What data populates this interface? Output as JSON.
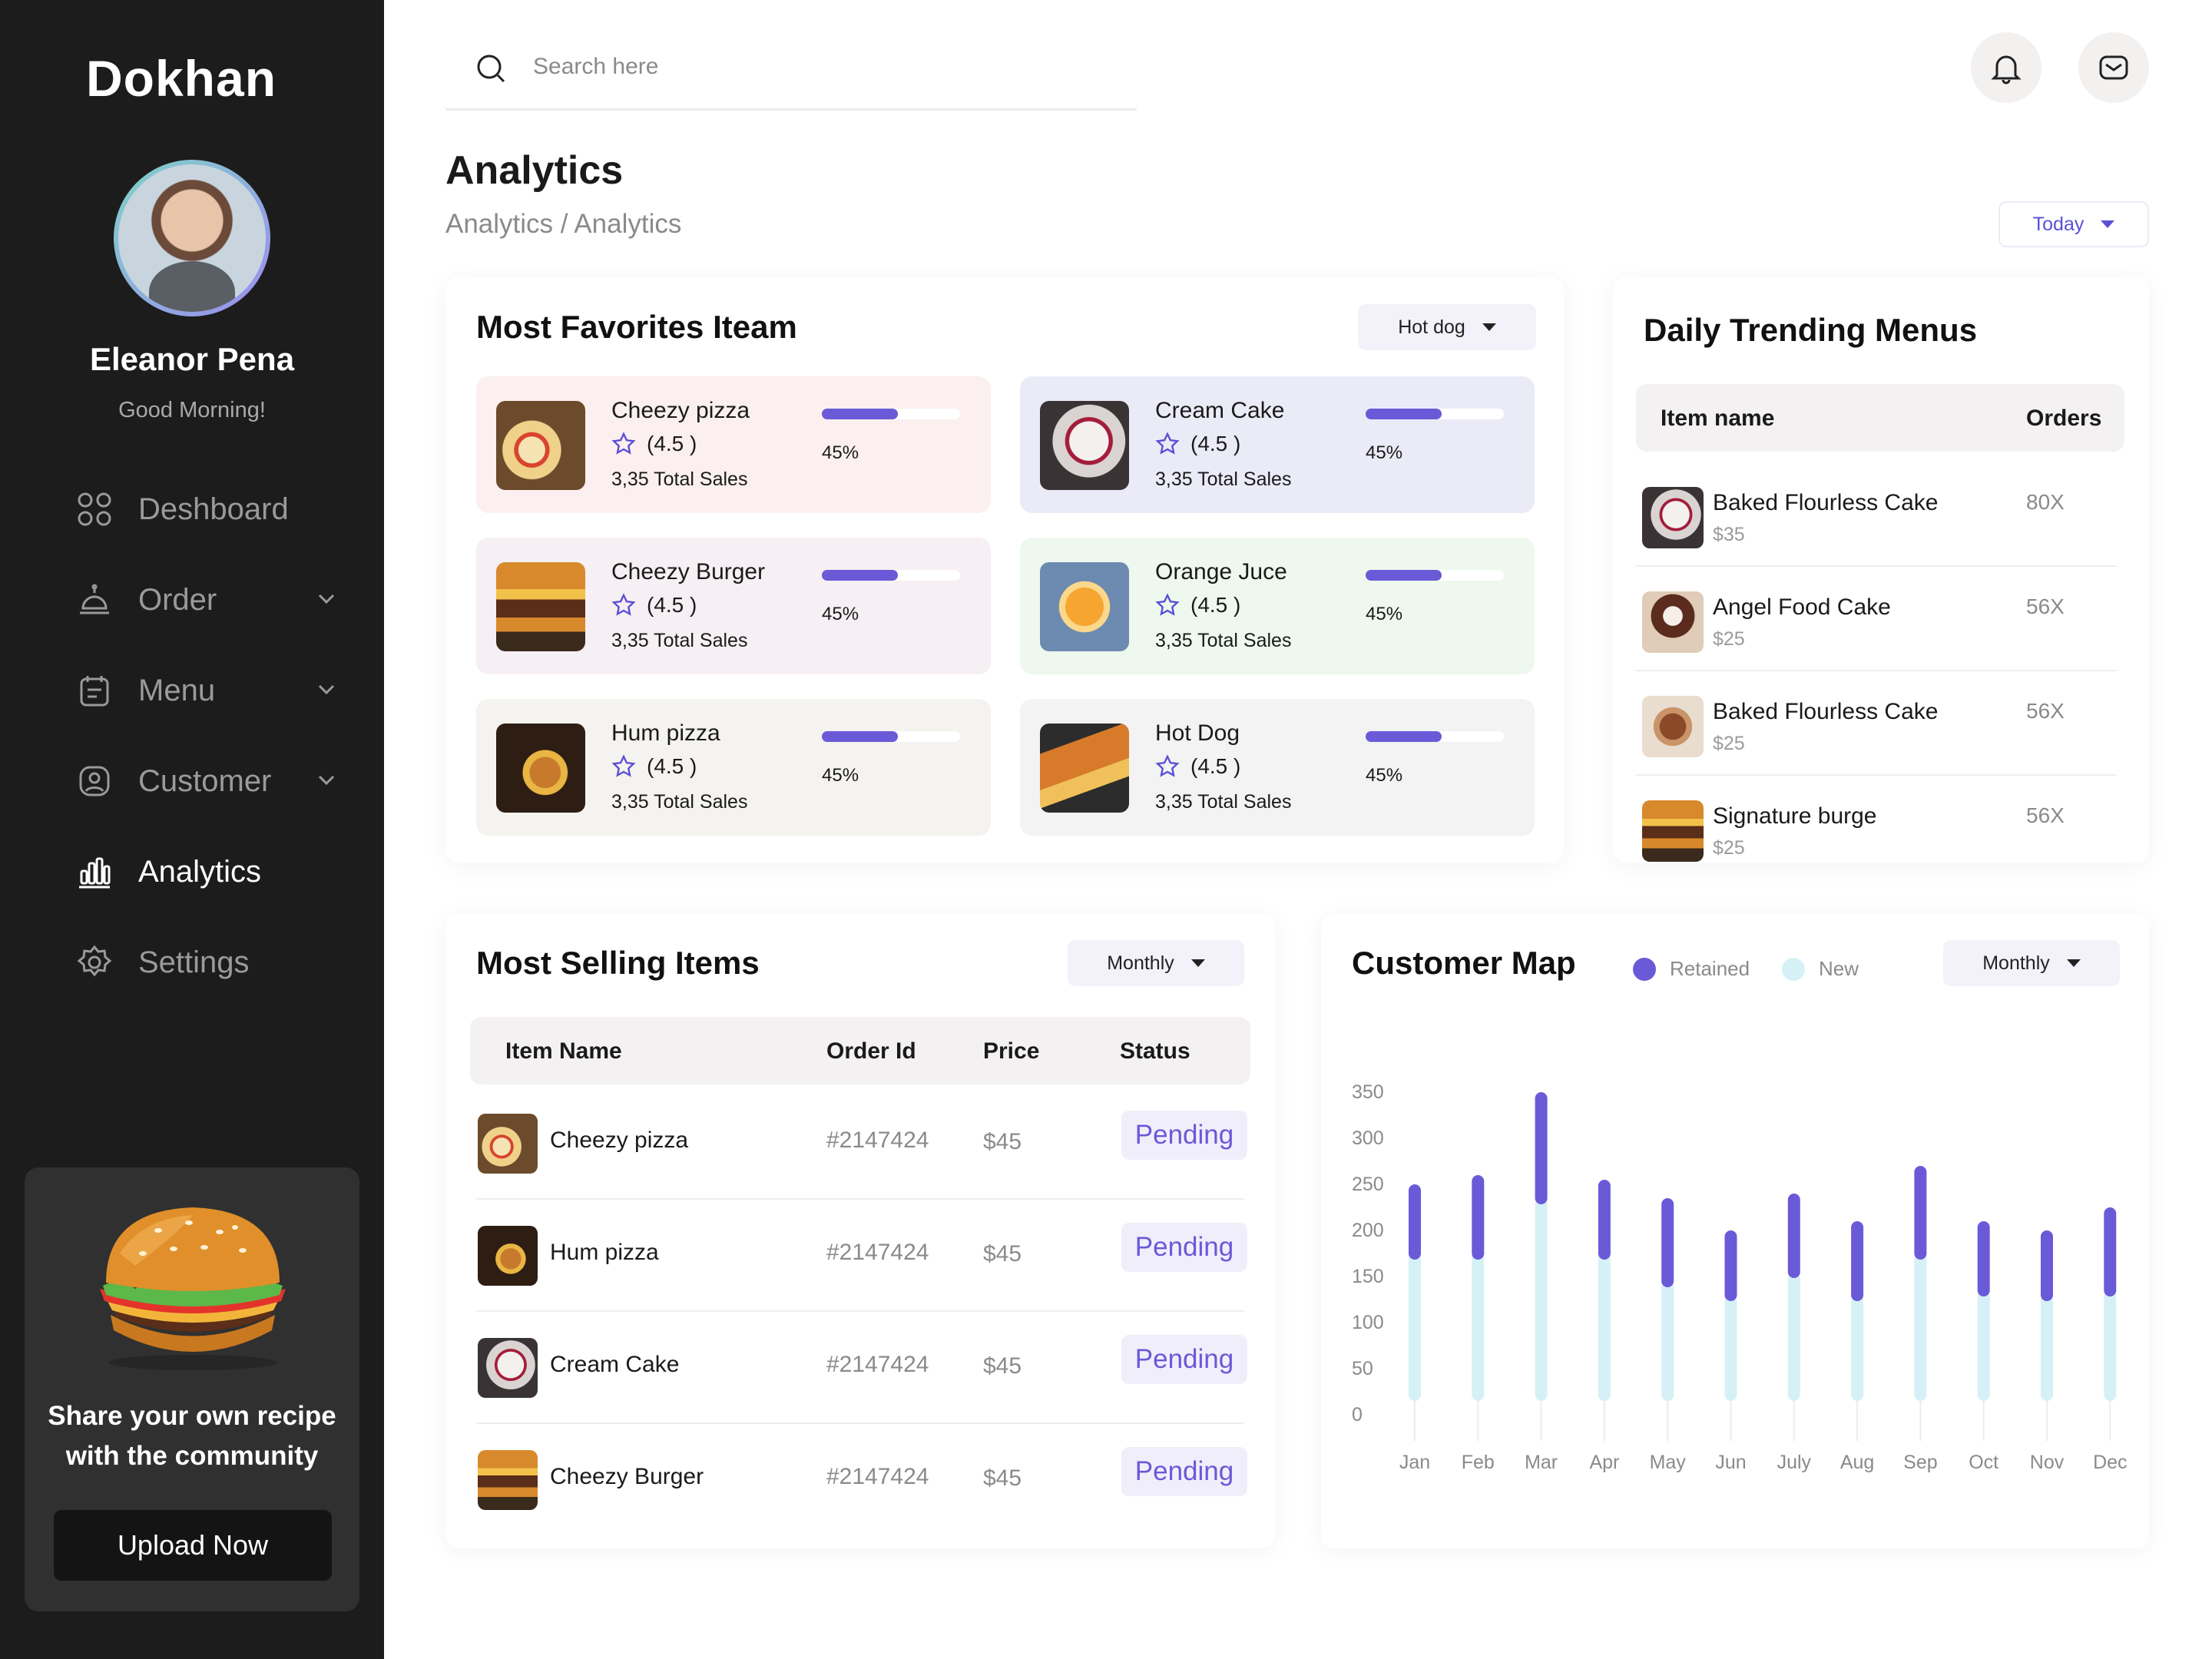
{
  "sidebar": {
    "logo": "Dokhan",
    "user_name": "Eleanor Pena",
    "greeting": "Good Morning!",
    "nav": [
      {
        "label": "Deshboard",
        "icon": "grid-icon"
      },
      {
        "label": "Order",
        "icon": "order-icon"
      },
      {
        "label": "Menu",
        "icon": "menu-icon"
      },
      {
        "label": "Customer",
        "icon": "customer-icon"
      },
      {
        "label": "Analytics",
        "icon": "analytics-icon"
      },
      {
        "label": "Settings",
        "icon": "settings-icon"
      }
    ],
    "promo": {
      "text_line1": "Share your own recipe",
      "text_line2": "with the community",
      "button": "Upload Now"
    }
  },
  "header": {
    "search_placeholder": "Search here",
    "title": "Analytics",
    "breadcrumb": "Analytics / Analytics",
    "period": "Today"
  },
  "favorites": {
    "title": "Most Favorites Iteam",
    "filter": "Hot dog",
    "items": [
      {
        "name": "Cheezy pizza",
        "rating": "(4.5 )",
        "sales": "3,35 Total Sales",
        "progress": 0.55,
        "pct": "45%",
        "bg": "#fbefef"
      },
      {
        "name": "Cream Cake",
        "rating": "(4.5 )",
        "sales": "3,35 Total Sales",
        "progress": 0.55,
        "pct": "45%",
        "bg": "#ebebf8"
      },
      {
        "name": "Cheezy Burger",
        "rating": "(4.5 )",
        "sales": "3,35 Total Sales",
        "progress": 0.55,
        "pct": "45%",
        "bg": "#f6eff3"
      },
      {
        "name": "Orange Juce",
        "rating": "(4.5 )",
        "sales": "3,35 Total Sales",
        "progress": 0.55,
        "pct": "45%",
        "bg": "#eef8ee"
      },
      {
        "name": "Hum pizza",
        "rating": "(4.5 )",
        "sales": "3,35 Total Sales",
        "progress": 0.55,
        "pct": "45%",
        "bg": "#f5f3ef"
      },
      {
        "name": "Hot Dog",
        "rating": "(4.5 )",
        "sales": "3,35 Total Sales",
        "progress": 0.55,
        "pct": "45%",
        "bg": "#f3f3f3"
      }
    ]
  },
  "trending": {
    "title": "Daily Trending Menus",
    "col_name": "Item name",
    "col_orders": "Orders",
    "rows": [
      {
        "name": "Baked Flourless Cake",
        "price": "$35",
        "orders": "80X"
      },
      {
        "name": "Angel Food Cake",
        "price": "$25",
        "orders": "56X"
      },
      {
        "name": "Baked Flourless Cake",
        "price": "$25",
        "orders": "56X"
      },
      {
        "name": "Signature burge",
        "price": "$25",
        "orders": "56X"
      }
    ]
  },
  "selling": {
    "title": "Most Selling Items",
    "filter": "Monthly",
    "columns": [
      "Item Name",
      "Order Id",
      "Price",
      "Status"
    ],
    "rows": [
      {
        "name": "Cheezy pizza",
        "order_id": "#2147424",
        "price": "$45",
        "status": "Pending"
      },
      {
        "name": "Hum pizza",
        "order_id": "#2147424",
        "price": "$45",
        "status": "Pending"
      },
      {
        "name": "Cream Cake",
        "order_id": "#2147424",
        "price": "$45",
        "status": "Pending"
      },
      {
        "name": "Cheezy Burger",
        "order_id": "#2147424",
        "price": "$45",
        "status": "Pending"
      }
    ]
  },
  "customer_map": {
    "title": "Customer Map",
    "legend_retained": "Retained",
    "legend_new": "New",
    "filter": "Monthly"
  },
  "chart_data": {
    "type": "bar",
    "stacked": true,
    "categories": [
      "Jan",
      "Feb",
      "Mar",
      "Apr",
      "May",
      "Jun",
      "July",
      "Aug",
      "Sep",
      "Oct",
      "Nov",
      "Dec"
    ],
    "series": [
      {
        "name": "New",
        "color": "#d6f1f6",
        "values": [
          160,
          160,
          220,
          160,
          130,
          115,
          140,
          115,
          160,
          120,
          115,
          120
        ]
      },
      {
        "name": "Retained",
        "color": "#6a5ad8",
        "values": [
          75,
          85,
          115,
          80,
          90,
          70,
          85,
          80,
          95,
          75,
          70,
          90
        ]
      }
    ],
    "yticks": [
      0,
      50,
      100,
      150,
      200,
      250,
      300,
      350
    ],
    "ylim": [
      0,
      350
    ],
    "grid": false
  }
}
